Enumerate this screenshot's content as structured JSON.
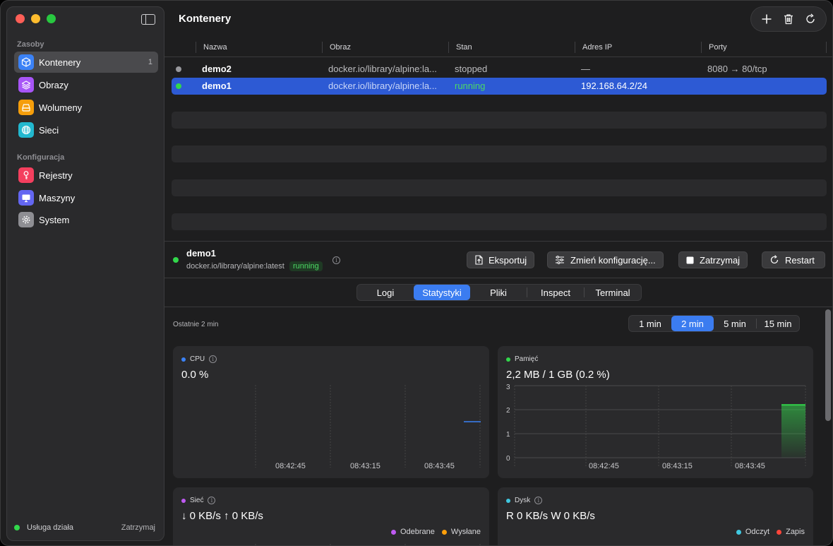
{
  "sidebar": {
    "section_resources": "Zasoby",
    "section_config": "Konfiguracja",
    "items": [
      {
        "label": "Kontenery",
        "count": "1"
      },
      {
        "label": "Obrazy"
      },
      {
        "label": "Wolumeny"
      },
      {
        "label": "Sieci"
      },
      {
        "label": "Rejestry"
      },
      {
        "label": "Maszyny"
      },
      {
        "label": "System"
      }
    ],
    "service_status": "Usługa działa",
    "service_stop": "Zatrzymaj"
  },
  "header": {
    "title": "Kontenery"
  },
  "table": {
    "columns": [
      "Nazwa",
      "Obraz",
      "Stan",
      "Adres IP",
      "Porty"
    ],
    "rows": [
      {
        "name": "demo2",
        "image": "docker.io/library/alpine:la...",
        "state": "stopped",
        "ip": "—",
        "ports": "8080 → 80/tcp",
        "status_color": "#98989d"
      },
      {
        "name": "demo1",
        "image": "docker.io/library/alpine:la...",
        "state": "running",
        "ip": "192.168.64.2/24",
        "ports": "",
        "status_color": "#32d74b"
      }
    ]
  },
  "detail": {
    "name": "demo1",
    "image": "docker.io/library/alpine:latest",
    "badge": "running",
    "buttons": {
      "export": "Eksportuj",
      "configure": "Zmień konfigurację...",
      "stop": "Zatrzymaj",
      "restart": "Restart"
    },
    "tabs": [
      "Logi",
      "Statystyki",
      "Pliki",
      "Inspect",
      "Terminal"
    ],
    "active_tab": "Statystyki"
  },
  "stats": {
    "range_label": "Ostatnie 2 min",
    "ranges": [
      "1 min",
      "2 min",
      "5 min",
      "15 min"
    ],
    "active_range": "2 min",
    "cpu": {
      "title": "CPU",
      "value": "0.0 %",
      "color": "#3b82f6"
    },
    "memory": {
      "title": "Pamięć",
      "value": "2,2 MB / 1 GB (0.2 %)",
      "color": "#32d74b"
    },
    "network": {
      "title": "Sieć",
      "value": "↓ 0 KB/s  ↑ 0 KB/s",
      "legend": [
        "Odebrane",
        "Wysłane"
      ],
      "colors": [
        "#bf5af2",
        "#ff9f0a"
      ]
    },
    "disk": {
      "title": "Dysk",
      "value": "R 0 KB/s  W 0 KB/s",
      "legend": [
        "Odczyt",
        "Zapis"
      ],
      "colors": [
        "#40c8e0",
        "#ff453a"
      ]
    }
  },
  "chart_data": [
    {
      "type": "line",
      "title": "CPU",
      "x_ticks": [
        "08:42:45",
        "08:43:15",
        "08:43:45"
      ],
      "series": [
        {
          "name": "CPU",
          "values": [
            0.0
          ]
        }
      ]
    },
    {
      "type": "area",
      "title": "Pamięć",
      "y_ticks": [
        "0",
        "1",
        "2",
        "3"
      ],
      "ylim": [
        0,
        3
      ],
      "x_ticks": [
        "08:42:45",
        "08:43:15",
        "08:43:45"
      ],
      "series": [
        {
          "name": "Pamięć",
          "values": [
            2.2,
            2.2
          ]
        }
      ]
    }
  ]
}
